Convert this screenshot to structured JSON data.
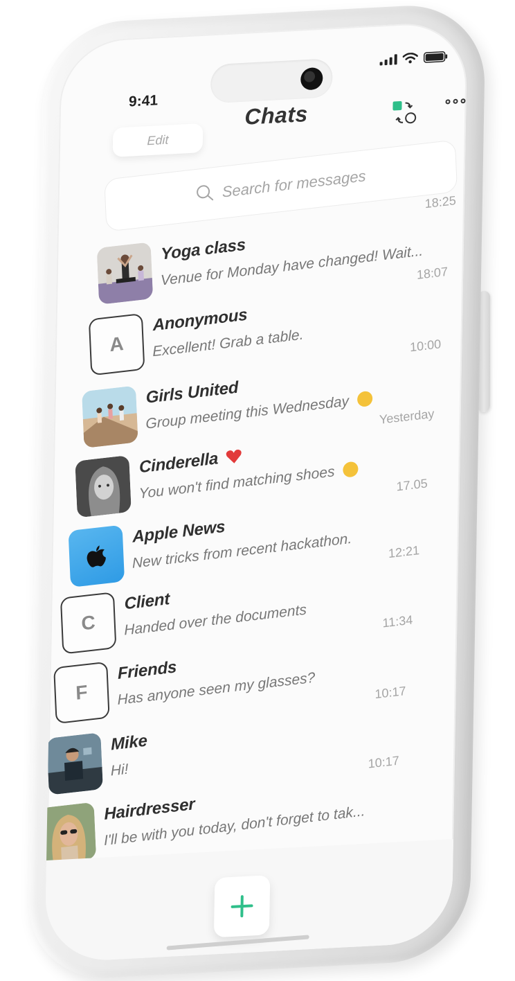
{
  "status_bar": {
    "time": "9:41"
  },
  "header": {
    "edit_label": "Edit",
    "title": "Chats",
    "swap_icon": "swap-icon",
    "more_icon": "more-icon"
  },
  "search": {
    "placeholder": "Search for messages",
    "icon": "search-icon"
  },
  "chats": [
    {
      "name": "Yoga class",
      "preview": "Venue for Monday have changed! Wait...",
      "time": "18:25",
      "avatar": "photo"
    },
    {
      "name": "Anonymous",
      "preview": "Excellent! Grab a table.",
      "time": "18:07",
      "avatar": "A"
    },
    {
      "name": "Girls United",
      "preview": "Group meeting this Wednesday",
      "time": "10:00",
      "avatar": "photo",
      "emoji": "sunglasses-emoji"
    },
    {
      "name": "Cinderella",
      "preview": "You won't find matching shoes",
      "time": "Yesterday",
      "avatar": "photo",
      "name_emoji": "heart-emoji",
      "emoji": "sweat-smile-emoji"
    },
    {
      "name": "Apple News",
      "preview": "New tricks from recent hackathon.",
      "time": "17.05",
      "avatar": "apple-logo"
    },
    {
      "name": "Client",
      "preview": "Handed over the documents",
      "time": "12:21",
      "avatar": "C"
    },
    {
      "name": "Friends",
      "preview": "Has anyone seen my glasses?",
      "time": "11:34",
      "avatar": "F"
    },
    {
      "name": "Mike",
      "preview": "Hi!",
      "time": "10:17",
      "avatar": "photo"
    },
    {
      "name": "Hairdresser",
      "preview": "I'll be with you today, don't forget to tak...",
      "time": "10:17",
      "avatar": "photo"
    }
  ],
  "footer": {
    "add_icon": "plus-icon"
  },
  "colors": {
    "accent": "#2fbf8a",
    "apple_blue": "#3aa3ea",
    "heart": "#e23a3a"
  }
}
